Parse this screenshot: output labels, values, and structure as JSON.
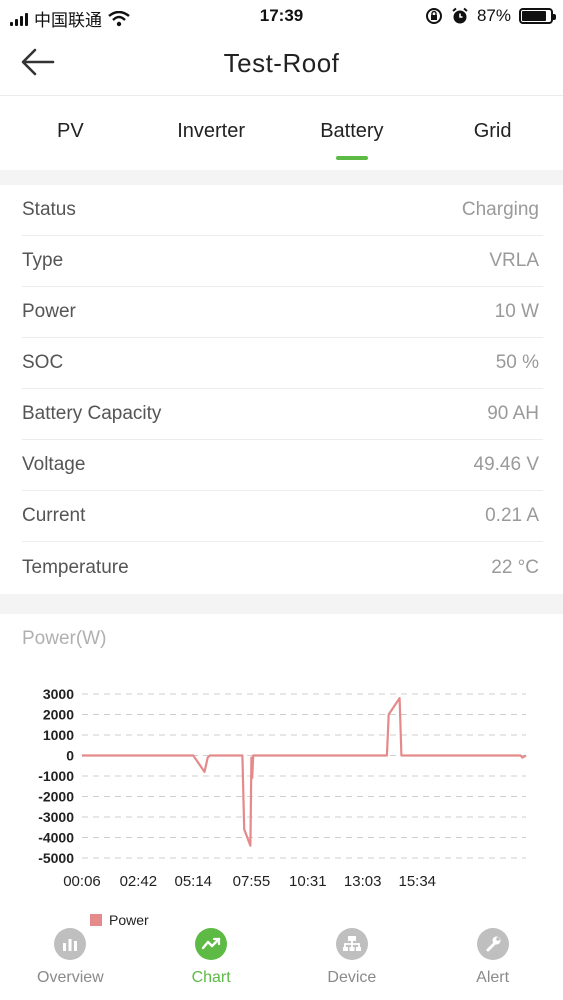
{
  "status_bar": {
    "carrier": "中国联通",
    "time": "17:39",
    "battery_percent": "87%",
    "battery_level": 0.87
  },
  "header": {
    "title": "Test-Roof",
    "back_icon": "arrow-left-icon"
  },
  "tabs": [
    {
      "label": "PV",
      "active": false
    },
    {
      "label": "Inverter",
      "active": false
    },
    {
      "label": "Battery",
      "active": true
    },
    {
      "label": "Grid",
      "active": false
    }
  ],
  "accent_color": "#5dba45",
  "battery_info": [
    {
      "label": "Status",
      "value": "Charging"
    },
    {
      "label": "Type",
      "value": "VRLA"
    },
    {
      "label": "Power",
      "value": "10 W"
    },
    {
      "label": "SOC",
      "value": "50 %"
    },
    {
      "label": "Battery Capacity",
      "value": "90 AH"
    },
    {
      "label": "Voltage",
      "value": "49.46 V"
    },
    {
      "label": "Current",
      "value": "0.21 A"
    },
    {
      "label": "Temperature",
      "value": "22 °C"
    }
  ],
  "chart_title": "Power(W)",
  "chart_data": {
    "type": "line",
    "title": "Power(W)",
    "x_tick_labels": [
      "00:06",
      "02:42",
      "05:14",
      "07:55",
      "10:31",
      "13:03",
      "15:34"
    ],
    "y_ticks": [
      3000,
      2000,
      1000,
      0,
      -1000,
      -2000,
      -3000,
      -4000,
      -5000
    ],
    "ylim": [
      -5000,
      3000
    ],
    "x_minutes_range": [
      6,
      1235
    ],
    "grid": true,
    "legend_position": "bottom-left",
    "series": [
      {
        "name": "Power",
        "color": "#e58a8a",
        "points": [
          [
            "00:06",
            0
          ],
          [
            "05:14",
            0
          ],
          [
            "05:45",
            -800
          ],
          [
            "05:54",
            -100
          ],
          [
            "06:00",
            0
          ],
          [
            "07:30",
            0
          ],
          [
            "07:35",
            -3600
          ],
          [
            "07:52",
            -4400
          ],
          [
            "07:55",
            -100
          ],
          [
            "07:57",
            -1100
          ],
          [
            "08:00",
            0
          ],
          [
            "14:10",
            0
          ],
          [
            "14:15",
            2000
          ],
          [
            "14:45",
            2800
          ],
          [
            "14:50",
            0
          ],
          [
            "20:20",
            0
          ],
          [
            "20:25",
            -100
          ],
          [
            "20:35",
            0
          ]
        ]
      }
    ]
  },
  "legend_label": "Power",
  "bottom_nav": [
    {
      "label": "Overview",
      "icon": "bar-chart-icon",
      "active": false
    },
    {
      "label": "Chart",
      "icon": "trend-line-icon",
      "active": true
    },
    {
      "label": "Device",
      "icon": "network-icon",
      "active": false
    },
    {
      "label": "Alert",
      "icon": "wrench-icon",
      "active": false
    }
  ]
}
